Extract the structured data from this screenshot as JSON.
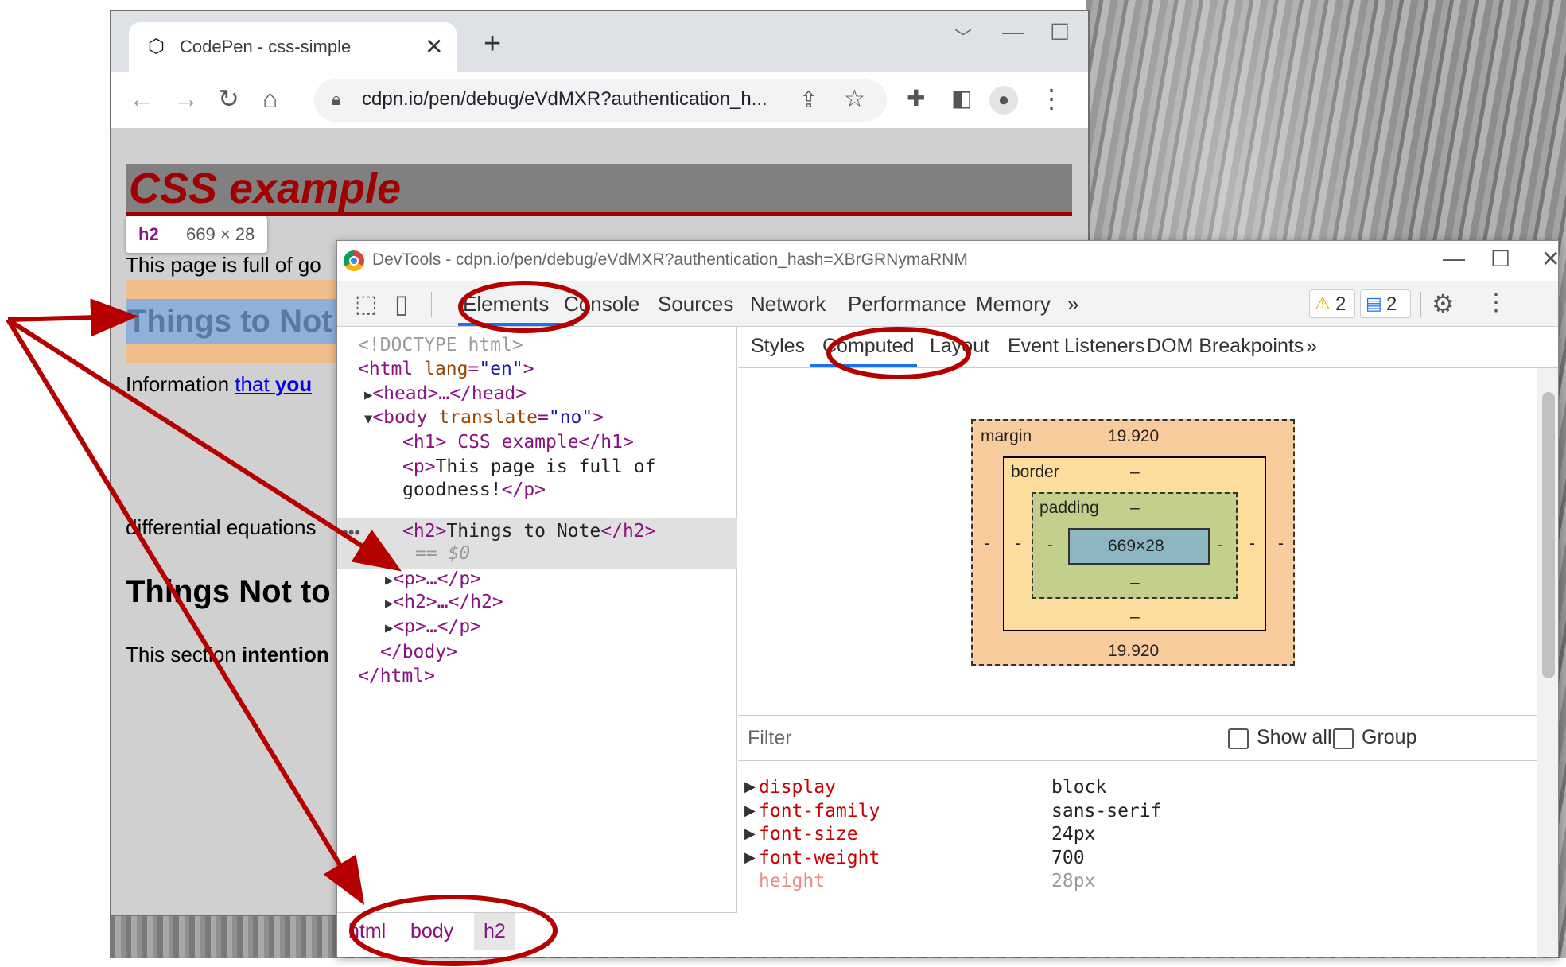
{
  "browser": {
    "tab_title": "CodePen - css-simple",
    "tab_close": "✕",
    "new_tab": "+",
    "url": "cdpn.io/pen/debug/eVdMXR?authentication_h...",
    "window_controls": [
      "﹀",
      "—",
      "☐",
      "✕"
    ],
    "icons": [
      "back-arrow-icon",
      "forward-arrow-icon",
      "reload-icon",
      "home-icon",
      "lock-icon",
      "share-icon",
      "star-icon",
      "extensions-icon",
      "sidebar-icon",
      "profile-icon",
      "more-icon"
    ]
  },
  "page": {
    "h1": "CSS example",
    "tooltip_tag": "h2",
    "tooltip_size": "669 × 28",
    "para1": "This page is full of go",
    "h2_selected": "Things to Not",
    "para2_prefix": "Information ",
    "para2_link_a": "that ",
    "para2_link_b": "you",
    "para3": "differential equations",
    "h2_second": "Things Not to",
    "para4_prefix": "This section ",
    "para4_bold": "intention"
  },
  "devtools": {
    "title": "DevTools - cdpn.io/pen/debug/eVdMXR?authentication_hash=XBrGRNymaRNM",
    "window_controls": [
      "—",
      "☐",
      "✕"
    ],
    "tabs": [
      "Elements",
      "Console",
      "Sources",
      "Network",
      "Performance",
      "Memory",
      "»"
    ],
    "warnings": "2",
    "messages": "2",
    "dom": {
      "doctype": "<!DOCTYPE html>",
      "html_open_tag": "<html",
      "html_attr": "lang",
      "html_val": "\"en\"",
      "head": "<head>…</head>",
      "body_open_tag": "<body",
      "body_attr": "translate",
      "body_val": "\"no\"",
      "h1_line": "<h1> CSS example</h1>",
      "p_open": "<p>",
      "p_text_a": "This page is full of",
      "p_text_b": "goodness!",
      "p_close": "</p>",
      "h2_open": "<h2>",
      "h2_text": "Things to Note",
      "h2_close": "</h2>",
      "dollar_zero": "== $0",
      "collapsed": [
        "<p>…</p>",
        "<h2>…</h2>",
        "<p>…</p>"
      ],
      "body_close": "</body>",
      "html_close": "</html>",
      "dots": "•••"
    },
    "breadcrumbs": [
      "html",
      "body",
      "h2"
    ],
    "sidebar_tabs": [
      "Styles",
      "Computed",
      "Layout",
      "Event Listeners",
      "DOM Breakpoints",
      "»"
    ],
    "box_model": {
      "margin_label": "margin",
      "margin_top": "19.920",
      "margin_bottom": "19.920",
      "margin_left": "-",
      "margin_right": "-",
      "border_label": "border",
      "border_top": "–",
      "border_bottom": "–",
      "border_left": "-",
      "border_right": "-",
      "padding_label": "padding",
      "padding_top": "–",
      "padding_bottom": "–",
      "padding_left": "-",
      "padding_right": "-",
      "content": "669×28"
    },
    "filter_placeholder": "Filter",
    "show_all": "Show all",
    "group": "Group",
    "computed": [
      {
        "name": "display",
        "value": "block"
      },
      {
        "name": "font-family",
        "value": "sans-serif"
      },
      {
        "name": "font-size",
        "value": "24px"
      },
      {
        "name": "font-weight",
        "value": "700"
      },
      {
        "name": "height",
        "value": "28px"
      }
    ]
  },
  "colors": {
    "annotation_red": "#b50000",
    "h1_red": "#a00000",
    "tag_purple": "#881280",
    "active_blue": "#1a73e8"
  }
}
